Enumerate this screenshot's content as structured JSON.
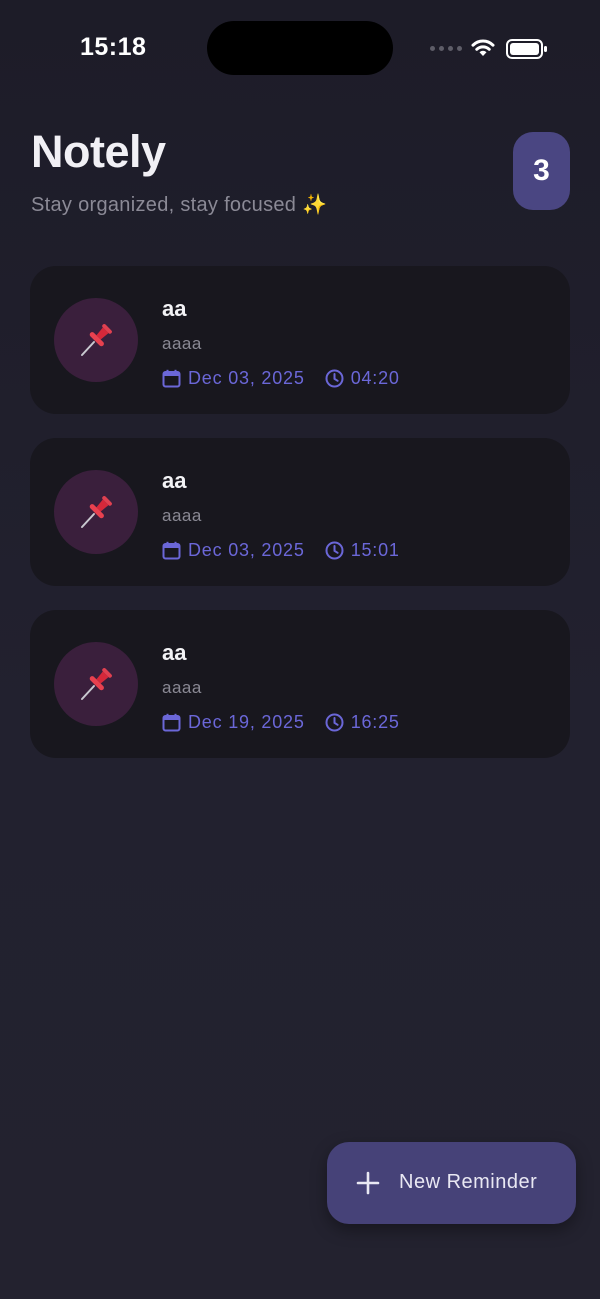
{
  "status_bar": {
    "time": "15:18",
    "signal_icon": "signal-dots-icon",
    "wifi_icon": "wifi-icon",
    "battery_icon": "battery-icon"
  },
  "header": {
    "title": "Notely",
    "subtitle": "Stay organized, stay focused ✨",
    "count": "3"
  },
  "reminders": [
    {
      "icon": "pushpin-icon",
      "title": "aa",
      "description": "aaaa",
      "date": "Dec 03, 2025",
      "time": "04:20"
    },
    {
      "icon": "pushpin-icon",
      "title": "aa",
      "description": "aaaa",
      "date": "Dec 03, 2025",
      "time": "15:01"
    },
    {
      "icon": "pushpin-icon",
      "title": "aa",
      "description": "aaaa",
      "date": "Dec 19, 2025",
      "time": "16:25"
    }
  ],
  "fab": {
    "label": "New Reminder",
    "icon": "plus-icon"
  },
  "colors": {
    "background": "#1d1c28",
    "card": "#18171e",
    "accent": "#6b67d8",
    "badge": "#4a4682",
    "fab": "#464278",
    "icon_circle": "#3a1f3c"
  }
}
